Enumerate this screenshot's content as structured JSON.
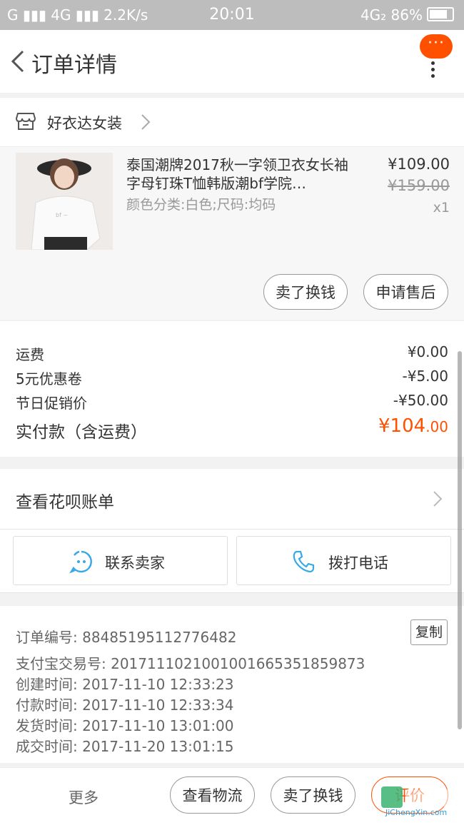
{
  "status_bar": {
    "left": "G ▮▮▮ 4G ▮▮▮ 2.2K/s",
    "time": "20:01",
    "right": "4G₂ 86%"
  },
  "header": {
    "title": "订单详情",
    "message_badge": "···"
  },
  "shop": {
    "name": "好衣达女装"
  },
  "product": {
    "title": "泰国潮牌2017秋一字领卫衣女长袖字母钉珠T恤韩版潮bf学院…",
    "spec": "颜色分类:白色;尺码:均码",
    "price": "¥109.00",
    "original_price": "¥159.00",
    "quantity": "x1",
    "btn_sell": "卖了换钱",
    "btn_after_sale": "申请售后"
  },
  "fees": {
    "shipping_label": "运费",
    "shipping_value": "¥0.00",
    "coupon_label": "5元优惠卷",
    "coupon_value": "-¥5.00",
    "promo_label": "节日促销价",
    "promo_value": "-¥50.00",
    "total_label": "实付款（含运费）",
    "total_int": "¥104",
    "total_dec": ".00"
  },
  "huabei": {
    "label": "查看花呗账单"
  },
  "contact": {
    "seller": "联系卖家",
    "call": "拨打电话"
  },
  "order_info": {
    "order_no": "订单编号: 88485195112776482",
    "alipay_no": "支付宝交易号: 2017111021001001665351859873",
    "created": "创建时间: 2017-11-10 12:33:23",
    "paid": "付款时间: 2017-11-10 12:33:34",
    "shipped": "发货时间: 2017-11-10 13:01:00",
    "completed": "成交时间: 2017-11-20 13:01:15",
    "copy": "复制"
  },
  "bottom_bar": {
    "more": "更多",
    "logistics": "查看物流",
    "sell": "卖了换钱",
    "review": "评价"
  },
  "watermark": {
    "text": "JiChengXin.com"
  },
  "colors": {
    "accent": "#ff5000",
    "status_bar": "#bdbdbd",
    "contact_icon": "#39a8e6"
  }
}
